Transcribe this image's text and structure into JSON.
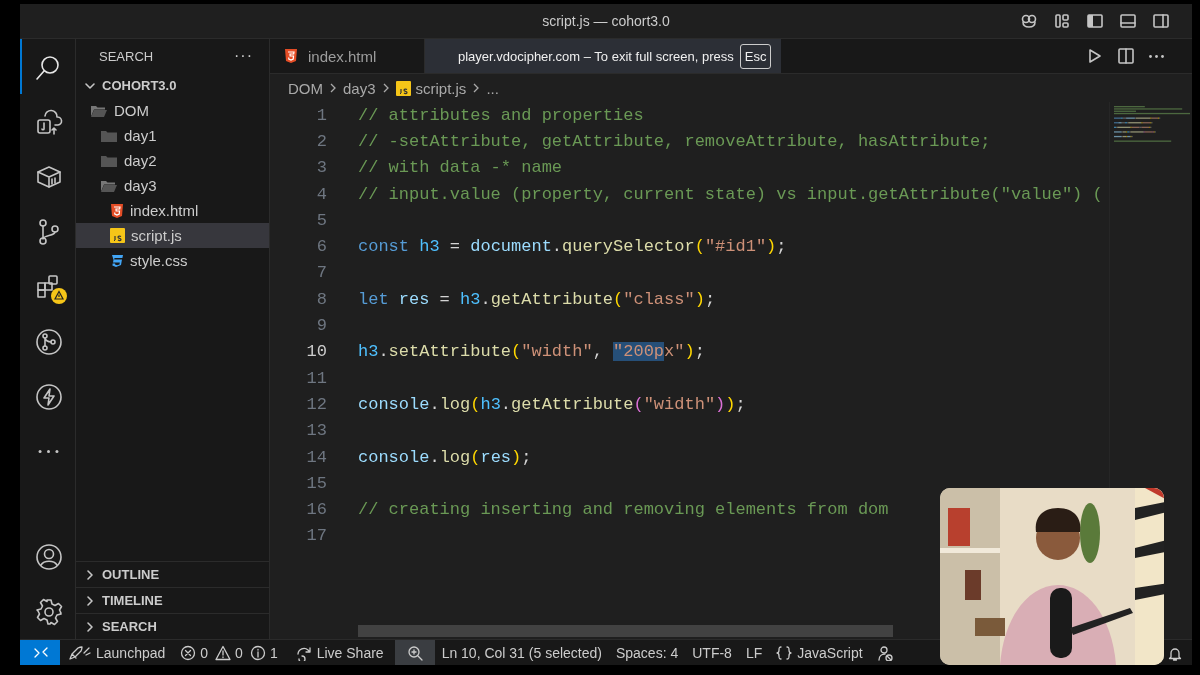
{
  "title_bar": {
    "title": "script.js — cohort3.0"
  },
  "activity_bar": {
    "items": [
      {
        "kind": "search",
        "selected": true
      },
      {
        "kind": "remote",
        "selected": false
      },
      {
        "kind": "box",
        "selected": false
      },
      {
        "kind": "branch",
        "selected": false
      },
      {
        "kind": "extensions",
        "selected": false,
        "warning": true
      },
      {
        "kind": "git",
        "selected": false
      },
      {
        "kind": "bolt",
        "selected": false
      },
      {
        "kind": "more",
        "selected": false
      }
    ],
    "bottom": [
      {
        "kind": "account"
      },
      {
        "kind": "settings"
      }
    ]
  },
  "sidebar": {
    "title": "SEARCH",
    "more": "···",
    "tree": {
      "label": "COHORT3.0",
      "expanded": true,
      "children": [
        {
          "label": "DOM",
          "kind": "folder",
          "expanded": true,
          "selected": false,
          "children": [
            {
              "label": "day1",
              "kind": "folder",
              "expanded": false,
              "selected": false
            },
            {
              "label": "day2",
              "kind": "folder",
              "expanded": false,
              "selected": false
            },
            {
              "label": "day3",
              "kind": "folder",
              "expanded": true,
              "selected": false,
              "children": [
                {
                  "label": "index.html",
                  "kind": "html",
                  "selected": false
                },
                {
                  "label": "script.js",
                  "kind": "js",
                  "selected": true
                },
                {
                  "label": "style.css",
                  "kind": "css",
                  "selected": false
                }
              ]
            }
          ]
        }
      ]
    },
    "sections": [
      {
        "label": "OUTLINE",
        "expanded": false
      },
      {
        "label": "TIMELINE",
        "expanded": false
      },
      {
        "label": "SEARCH",
        "expanded": false
      }
    ]
  },
  "tabs": [
    {
      "label": "index.html",
      "kind": "html",
      "selected": false
    }
  ],
  "fullscreen_notice": {
    "text": "player.vdocipher.com – To exit full screen, press",
    "key": "Esc"
  },
  "breadcrumbs": [
    {
      "label": "DOM",
      "kind": "folder"
    },
    {
      "label": "day3",
      "kind": "folder"
    },
    {
      "label": "script.js",
      "kind": "js"
    },
    {
      "label": "...",
      "kind": "symbol"
    }
  ],
  "editor": {
    "lines": [
      {
        "number": "1",
        "selected": false,
        "tokens": [
          {
            "kind": "comment",
            "text": "// attributes and properties"
          }
        ]
      },
      {
        "number": "2",
        "selected": false,
        "tokens": [
          {
            "kind": "comment",
            "text": "// -setAttribute, getAttribute, removeAttribute, hasAttribute;"
          }
        ]
      },
      {
        "number": "3",
        "selected": false,
        "tokens": [
          {
            "kind": "comment",
            "text": "// with data -* name"
          }
        ]
      },
      {
        "number": "4",
        "selected": false,
        "tokens": [
          {
            "kind": "comment",
            "text": "// input.value (property, current state) vs input.getAttribute(\"value\") ("
          }
        ]
      },
      {
        "number": "5",
        "selected": false
      },
      {
        "number": "6",
        "selected": false,
        "tokens": [
          {
            "kind": "keyword",
            "text": "const "
          },
          {
            "kind": "constant",
            "text": "h3"
          },
          {
            "kind": "plain",
            "text": " = "
          },
          {
            "kind": "variable",
            "text": "document"
          },
          {
            "kind": "plain",
            "text": "."
          },
          {
            "kind": "function",
            "text": "querySelector"
          },
          {
            "kind": "bracket1",
            "text": "("
          },
          {
            "kind": "string",
            "text": "\"#id1\""
          },
          {
            "kind": "bracket1",
            "text": ")"
          },
          {
            "kind": "plain",
            "text": ";"
          }
        ]
      },
      {
        "number": "7",
        "selected": false
      },
      {
        "number": "8",
        "selected": false,
        "tokens": [
          {
            "kind": "keyword",
            "text": "let "
          },
          {
            "kind": "variable",
            "text": "res"
          },
          {
            "kind": "plain",
            "text": " = "
          },
          {
            "kind": "constant",
            "text": "h3"
          },
          {
            "kind": "plain",
            "text": "."
          },
          {
            "kind": "function",
            "text": "getAttribute"
          },
          {
            "kind": "bracket1",
            "text": "("
          },
          {
            "kind": "string",
            "text": "\"class\""
          },
          {
            "kind": "bracket1",
            "text": ")"
          },
          {
            "kind": "plain",
            "text": ";"
          }
        ]
      },
      {
        "number": "9",
        "selected": false
      },
      {
        "number": "10",
        "selected": true,
        "tokens": [
          {
            "kind": "constant",
            "text": "h3"
          },
          {
            "kind": "plain",
            "text": "."
          },
          {
            "kind": "function",
            "text": "setAttribute"
          },
          {
            "kind": "bracket1",
            "text": "("
          },
          {
            "kind": "string",
            "text": "\"width\""
          },
          {
            "kind": "plain",
            "text": ", "
          },
          {
            "kind": "string",
            "text": "\"200p",
            "selected": true
          },
          {
            "kind": "string",
            "text": "x\""
          },
          {
            "kind": "bracket1",
            "text": ")"
          },
          {
            "kind": "plain",
            "text": ";"
          }
        ]
      },
      {
        "number": "11",
        "selected": false
      },
      {
        "number": "12",
        "selected": false,
        "tokens": [
          {
            "kind": "variable",
            "text": "console"
          },
          {
            "kind": "plain",
            "text": "."
          },
          {
            "kind": "function",
            "text": "log"
          },
          {
            "kind": "bracket1",
            "text": "("
          },
          {
            "kind": "constant",
            "text": "h3"
          },
          {
            "kind": "plain",
            "text": "."
          },
          {
            "kind": "function",
            "text": "getAttribute"
          },
          {
            "kind": "bracket2",
            "text": "("
          },
          {
            "kind": "string",
            "text": "\"width\""
          },
          {
            "kind": "bracket2",
            "text": ")"
          },
          {
            "kind": "bracket1",
            "text": ")"
          },
          {
            "kind": "plain",
            "text": ";"
          }
        ]
      },
      {
        "number": "13",
        "selected": false
      },
      {
        "number": "14",
        "selected": false,
        "tokens": [
          {
            "kind": "variable",
            "text": "console"
          },
          {
            "kind": "plain",
            "text": "."
          },
          {
            "kind": "function",
            "text": "log"
          },
          {
            "kind": "bracket1",
            "text": "("
          },
          {
            "kind": "variable",
            "text": "res"
          },
          {
            "kind": "bracket1",
            "text": ")"
          },
          {
            "kind": "plain",
            "text": ";"
          }
        ]
      },
      {
        "number": "15",
        "selected": false
      },
      {
        "number": "16",
        "selected": false,
        "tokens": [
          {
            "kind": "comment",
            "text": "// creating inserting and removing elements from dom"
          }
        ]
      },
      {
        "number": "17",
        "selected": false
      }
    ]
  },
  "status_bar": {
    "items": [
      {
        "kind": "remote"
      },
      {
        "kind": "launchpad",
        "text": "Launchpad"
      },
      {
        "kind": "error",
        "text": "0"
      },
      {
        "kind": "warning",
        "text": "0"
      },
      {
        "kind": "info",
        "text": "1"
      },
      {
        "kind": "liveshare",
        "text": "Live Share"
      },
      {
        "kind": "zoom"
      },
      {
        "kind": "text",
        "text": "Ln 10, Col 31 (5 selected)"
      },
      {
        "kind": "text",
        "text": "Spaces: 4"
      },
      {
        "kind": "text",
        "text": "UTF-8"
      },
      {
        "kind": "text",
        "text": "LF"
      },
      {
        "kind": "language",
        "text": "JavaScript"
      },
      {
        "kind": "accounts"
      },
      {
        "kind": "bell"
      }
    ]
  }
}
